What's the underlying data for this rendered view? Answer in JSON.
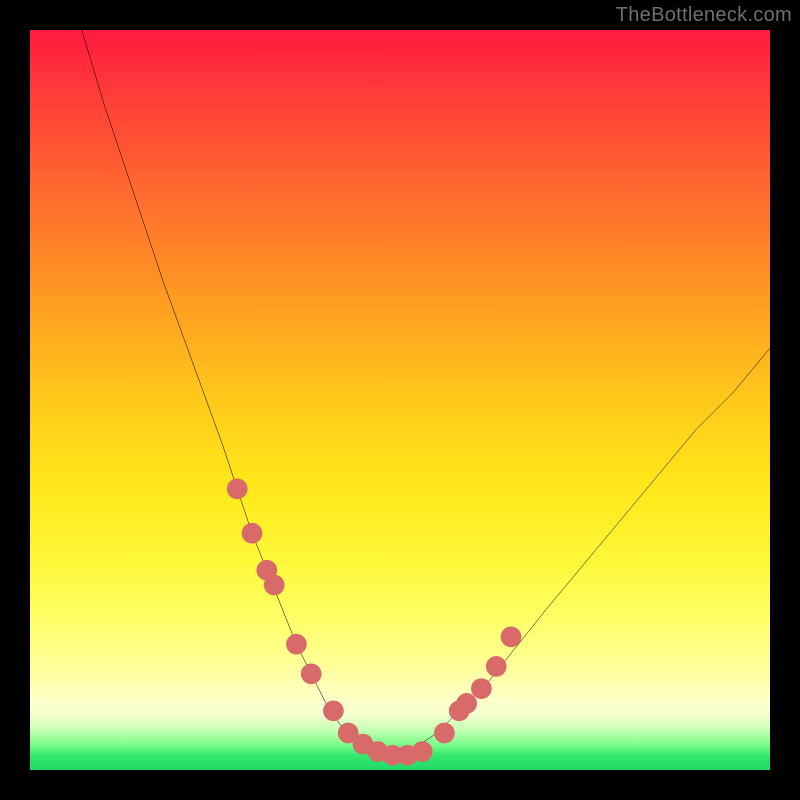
{
  "watermark": "TheBottleneck.com",
  "chart_data": {
    "type": "line",
    "title": "",
    "xlabel": "",
    "ylabel": "",
    "xlim": [
      0,
      100
    ],
    "ylim": [
      0,
      100
    ],
    "grid": false,
    "legend": false,
    "curve": {
      "name": "bottleneck-curve",
      "color": "#000000",
      "x": [
        7,
        10,
        14,
        18,
        22,
        26,
        28,
        30,
        32,
        34,
        36,
        38,
        40,
        42,
        44,
        46,
        48,
        50,
        52,
        55,
        58,
        62,
        66,
        70,
        75,
        80,
        85,
        90,
        95,
        100
      ],
      "y": [
        100,
        90,
        78,
        66,
        55,
        44,
        38,
        32,
        27,
        22,
        17,
        13,
        9,
        6,
        4,
        3,
        2,
        2,
        3,
        5,
        8,
        12,
        17,
        22,
        28,
        34,
        40,
        46,
        51,
        57
      ]
    },
    "markers": {
      "name": "gpu-markers",
      "color": "#d86a6a",
      "radius_pct": 1.4,
      "x": [
        28,
        30,
        32,
        33,
        36,
        38,
        41,
        43,
        45,
        47,
        49,
        51,
        53,
        56,
        58,
        59,
        61,
        63,
        65
      ],
      "y": [
        38,
        32,
        27,
        25,
        17,
        13,
        8,
        5,
        3.5,
        2.5,
        2,
        2,
        2.5,
        5,
        8,
        9,
        11,
        14,
        18
      ]
    }
  }
}
